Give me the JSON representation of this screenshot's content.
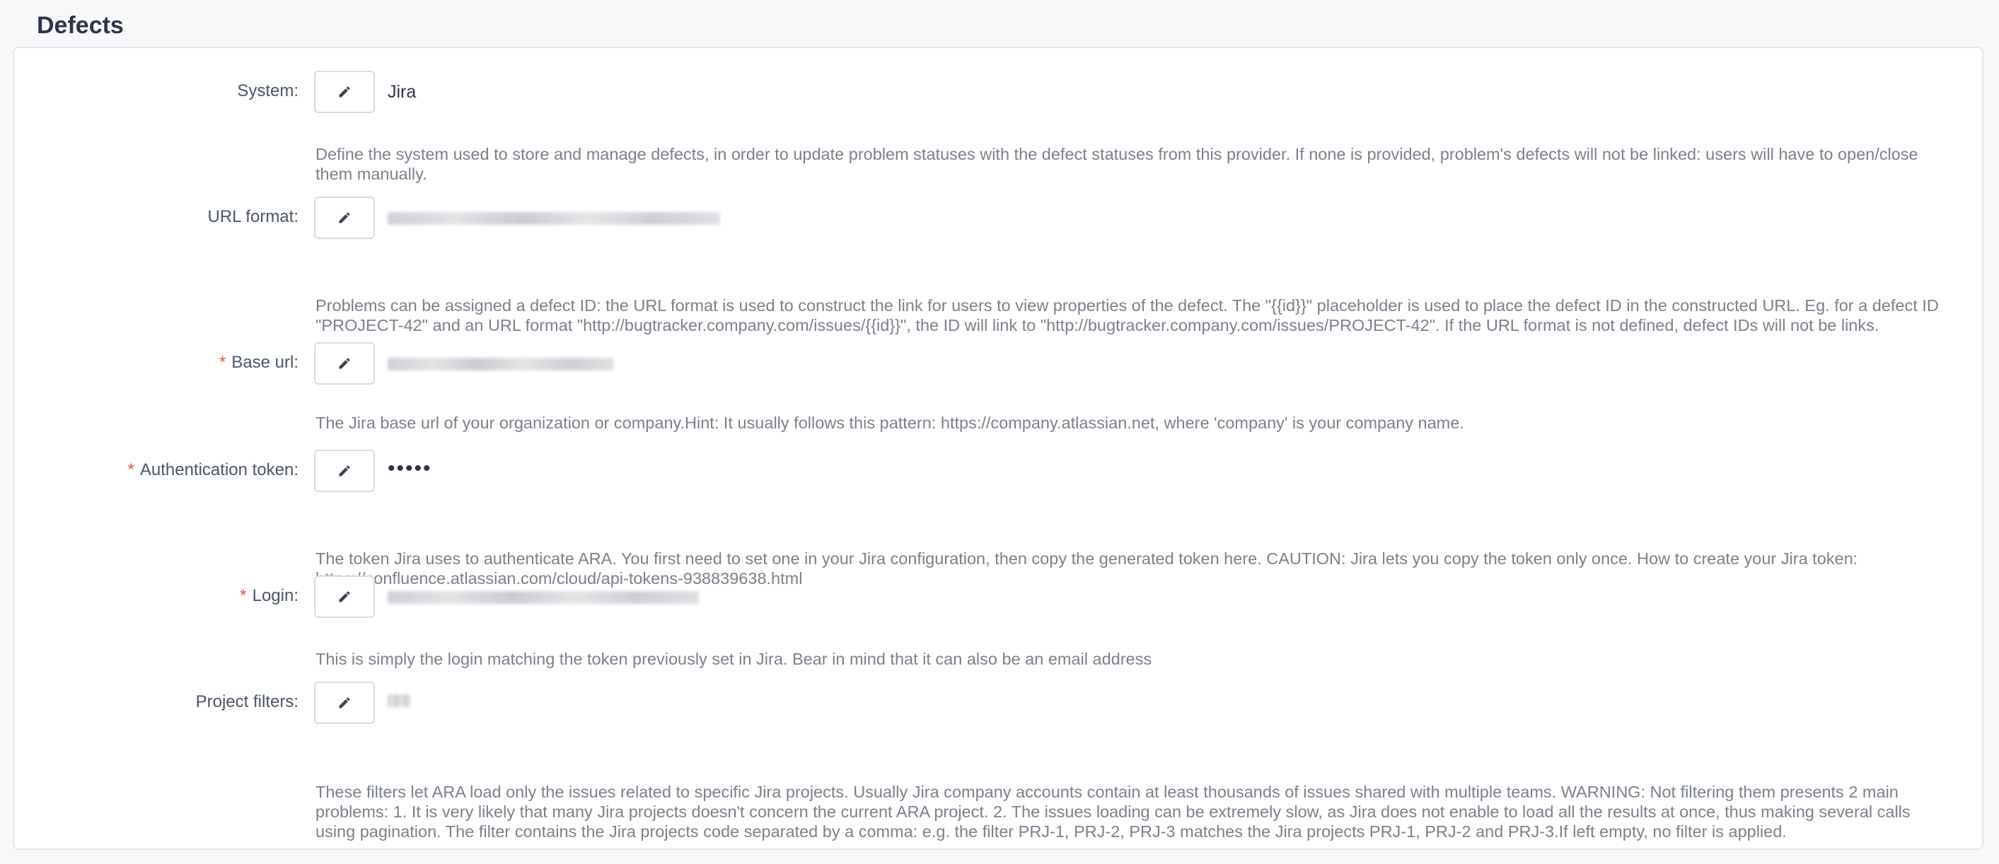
{
  "page": {
    "title": "Defects"
  },
  "fields": [
    {
      "label": "System:",
      "required": false,
      "value": "Jira",
      "description": "Define the system used to store and manage defects, in order to update problem statuses with the defect statuses from this provider. If none is provided, problem's defects will not be linked: users will have to open/close them manually."
    },
    {
      "label": "URL format:",
      "required": false,
      "value": "",
      "description": "Problems can be assigned a defect ID: the URL format is used to construct the link for users to view properties of the defect. The \"{{id}}\" placeholder is used to place the defect ID in the constructed URL. Eg. for a defect ID \"PROJECT-42\" and an URL format \"http://bugtracker.company.com/issues/{{id}}\", the ID will link to \"http://bugtracker.company.com/issues/PROJECT-42\". If the URL format is not defined, defect IDs will not be links."
    },
    {
      "label": "Base url:",
      "required": true,
      "value": "",
      "description": "The Jira base url of your organization or company.Hint: It usually follows this pattern: https://company.atlassian.net, where 'company' is your company name."
    },
    {
      "label": "Authentication token:",
      "required": true,
      "value": "•••••",
      "description": "The token Jira uses to authenticate ARA. You first need to set one in your Jira configuration, then copy the generated token here. CAUTION: Jira lets you copy the token only once. How to create your Jira token: https://confluence.atlassian.com/cloud/api-tokens-938839638.html"
    },
    {
      "label": "Login:",
      "required": true,
      "value": "",
      "description": "This is simply the login matching the token previously set in Jira. Bear in mind that it can also be an email address"
    },
    {
      "label": "Project filters:",
      "required": false,
      "value": "",
      "description": "These filters let ARA load only the issues related to specific Jira projects. Usually Jira company accounts contain at least thousands of issues shared with multiple teams. WARNING: Not filtering them presents 2 main problems: 1. It is very likely that many Jira projects doesn't concern the current ARA project. 2. The issues loading can be extremely slow, as Jira does not enable to load all the results at once, thus making several calls using pagination. The filter contains the Jira projects code separated by a comma: e.g. the filter PRJ-1, PRJ-2, PRJ-3 matches the Jira projects PRJ-1, PRJ-2 and PRJ-3.If left empty, no filter is applied."
    }
  ],
  "icons": {
    "edit": "pencil-icon"
  },
  "colors": {
    "required": "#e5534b",
    "description": "#7a818c",
    "border": "#d8dce2"
  }
}
